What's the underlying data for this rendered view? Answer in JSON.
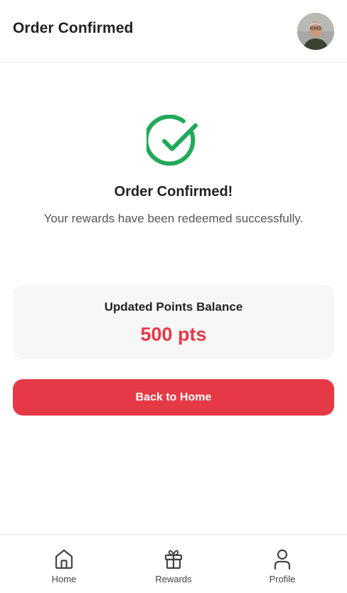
{
  "header": {
    "title": "Order Confirmed",
    "avatar_icon": "user-avatar-photo"
  },
  "confirmation": {
    "icon": "check-circle-icon",
    "title": "Order Confirmed!",
    "message": "Your rewards have been redeemed successfully."
  },
  "balance": {
    "label": "Updated Points Balance",
    "value": "500 pts"
  },
  "actions": {
    "back_label": "Back to Home"
  },
  "nav": {
    "items": [
      {
        "label": "Home",
        "icon": "home-icon"
      },
      {
        "label": "Rewards",
        "icon": "gift-icon"
      },
      {
        "label": "Profile",
        "icon": "user-icon"
      }
    ]
  },
  "colors": {
    "accent": "#e63946",
    "success": "#22a85a",
    "card_bg": "#f7f7f7"
  }
}
